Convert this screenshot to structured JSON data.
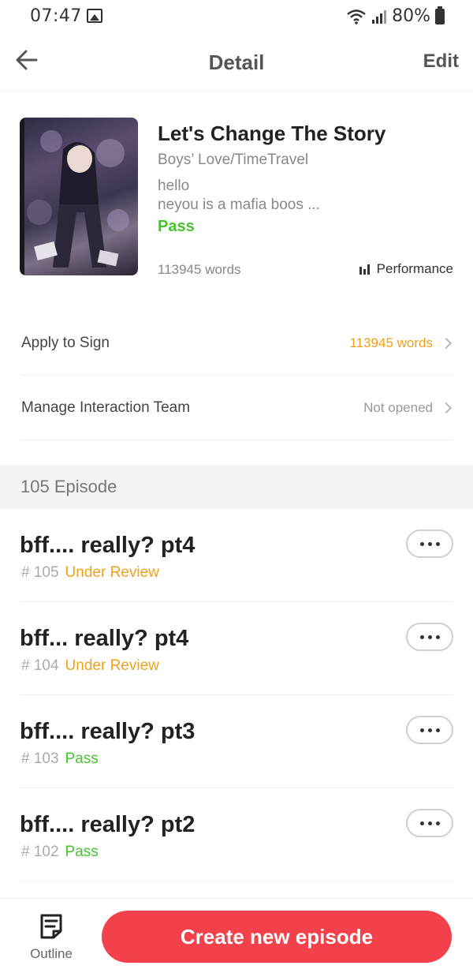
{
  "status_bar": {
    "time": "07:47",
    "battery": "80%"
  },
  "header": {
    "title": "Detail",
    "edit_label": "Edit"
  },
  "book": {
    "title": "Let's Change The Story",
    "genre": "Boys’ Love/TimeTravel",
    "description_line1": "hello",
    "description_line2": "neyou is a mafia boos ...",
    "status": "Pass",
    "words": "113945 words",
    "performance_label": "Performance"
  },
  "rows": {
    "apply": {
      "label": "Apply to Sign",
      "value": "113945 words"
    },
    "manage": {
      "label": "Manage Interaction Team",
      "value": "Not opened"
    }
  },
  "episodes_header": "105 Episode",
  "episodes": [
    {
      "title": "bff.... really? pt4",
      "number": "# 105",
      "status": "Under Review"
    },
    {
      "title": "bff... really? pt4",
      "number": "# 104",
      "status": "Under Review"
    },
    {
      "title": "bff.... really? pt3",
      "number": "# 103",
      "status": "Pass"
    },
    {
      "title": "bff.... really? pt2",
      "number": "# 102",
      "status": "Pass"
    }
  ],
  "bottom": {
    "outline_label": "Outline",
    "create_label": "Create new episode"
  },
  "colors": {
    "accent": "#f3414c",
    "pass": "#45c42e",
    "review": "#f0a21e"
  }
}
